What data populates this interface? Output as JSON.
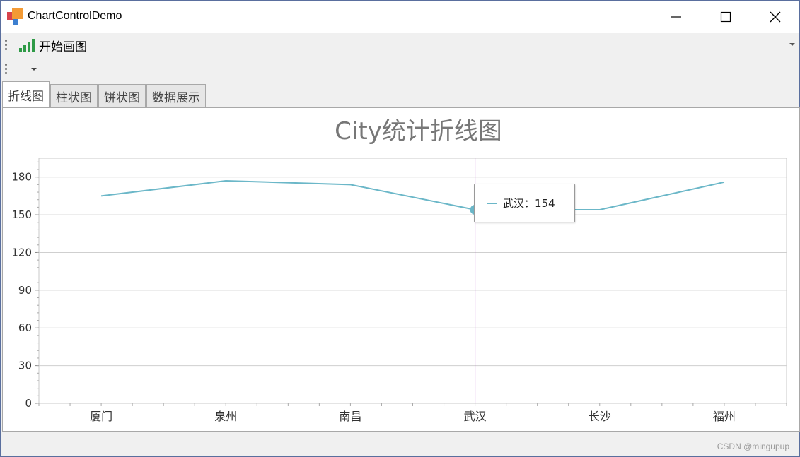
{
  "window": {
    "title": "ChartControlDemo"
  },
  "toolbar": {
    "start_label": "开始画图"
  },
  "tabs": [
    {
      "label": "折线图",
      "active": true
    },
    {
      "label": "柱状图",
      "active": false
    },
    {
      "label": "饼状图",
      "active": false
    },
    {
      "label": "数据展示",
      "active": false
    }
  ],
  "tooltip": {
    "text": "武汉：154"
  },
  "watermark": "CSDN @mingupup",
  "colors": {
    "series_line": "#6bb7c8",
    "crosshair": "#b040c0",
    "title": "#777777"
  },
  "chart_data": {
    "type": "line",
    "title": "City统计折线图",
    "categories": [
      "厦门",
      "泉州",
      "南昌",
      "武汉",
      "长沙",
      "福州"
    ],
    "values": [
      165,
      177,
      174,
      154,
      154,
      176
    ],
    "ylim": [
      0,
      195
    ],
    "yticks": [
      0,
      30,
      60,
      90,
      120,
      150,
      180
    ],
    "grid": true,
    "highlight_index": 3
  }
}
